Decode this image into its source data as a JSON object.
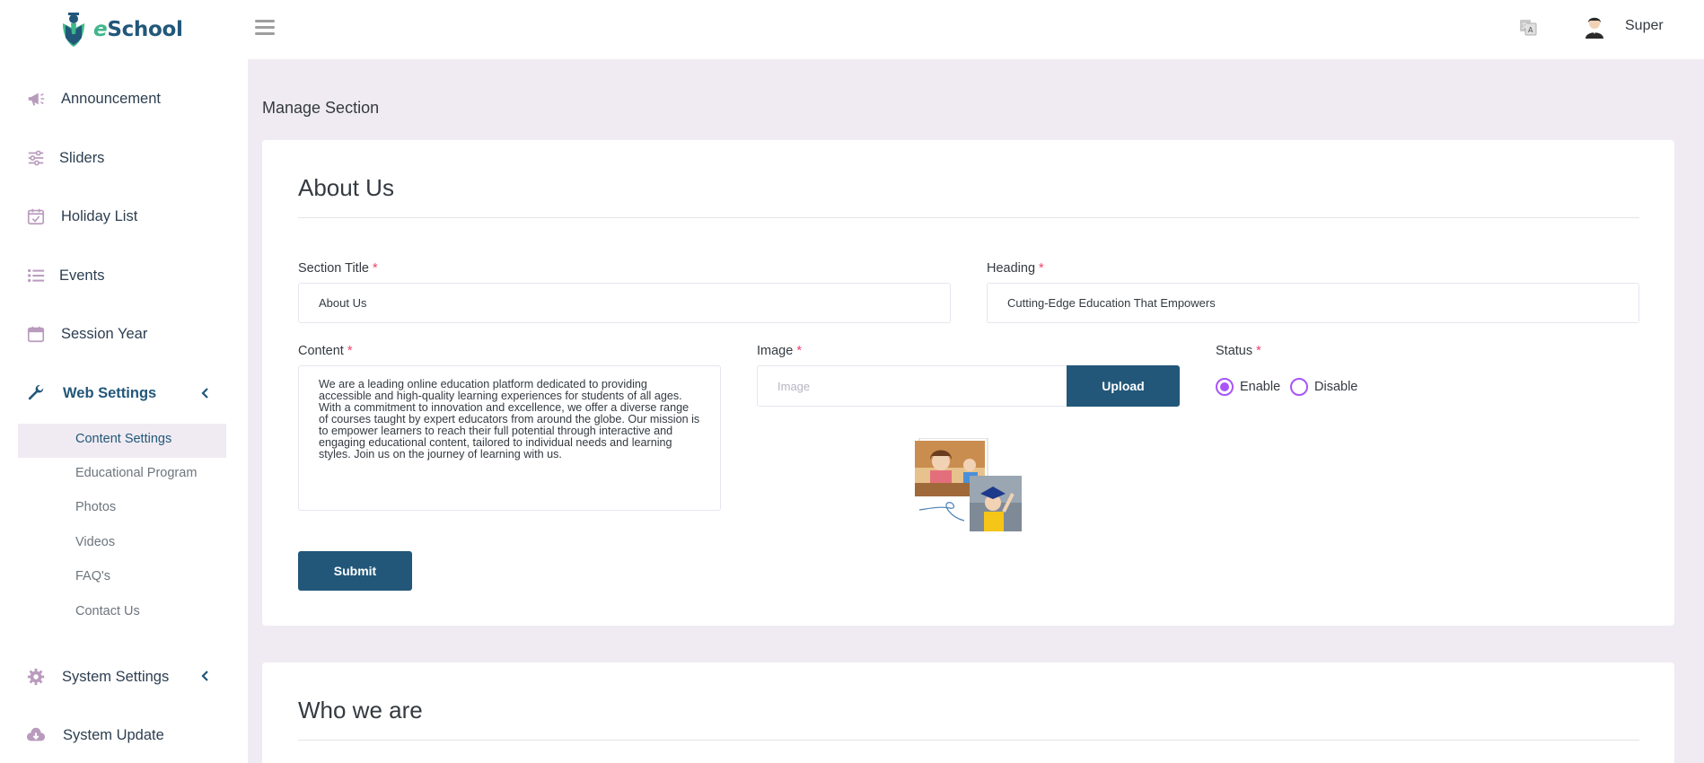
{
  "app": {
    "logo_e": "e",
    "logo_rest": "School"
  },
  "sidebar": {
    "items": [
      {
        "label": "Announcement",
        "icon": "megaphone-icon"
      },
      {
        "label": "Sliders",
        "icon": "sliders-icon"
      },
      {
        "label": "Holiday List",
        "icon": "calendar-check-icon"
      },
      {
        "label": "Events",
        "icon": "list-icon"
      },
      {
        "label": "Session Year",
        "icon": "calendar-icon"
      },
      {
        "label": "Web Settings",
        "icon": "wrench-icon",
        "expanded": true
      },
      {
        "label": "System Settings",
        "icon": "gear-icon"
      },
      {
        "label": "System Update",
        "icon": "cloud-download-icon"
      }
    ],
    "web_settings_sub": [
      {
        "label": "Content Settings",
        "active": true
      },
      {
        "label": "Educational Program"
      },
      {
        "label": "Photos"
      },
      {
        "label": "Videos"
      },
      {
        "label": "FAQ's"
      },
      {
        "label": "Contact Us"
      }
    ]
  },
  "header": {
    "username": "Super"
  },
  "main": {
    "page_title": "Manage Section",
    "about": {
      "card_title": "About Us",
      "section_title_label": "Section Title",
      "section_title_value": "About Us",
      "heading_label": "Heading",
      "heading_value": "Cutting-Edge Education That Empowers",
      "content_label": "Content",
      "content_value": "We are a leading online education platform dedicated to providing accessible and high-quality learning experiences for students of all ages. With a commitment to innovation and excellence, we offer a diverse range of courses taught by expert educators from around the globe. Our mission is to empower learners to reach their full potential through interactive and engaging educational content, tailored to individual needs and learning styles. Join us on the journey of learning with us.",
      "image_label": "Image",
      "image_placeholder": "Image",
      "upload_label": "Upload",
      "status_label": "Status",
      "status_options": [
        "Enable",
        "Disable"
      ],
      "status_selected": "Enable",
      "required_mark": "*",
      "submit_label": "Submit"
    },
    "who": {
      "card_title": "Who we are"
    }
  },
  "colors": {
    "primary": "#22577a",
    "accent_purple": "#a855f7",
    "required": "#f1416c",
    "background": "#f0ebf2",
    "logo_green": "#3fb68b"
  }
}
